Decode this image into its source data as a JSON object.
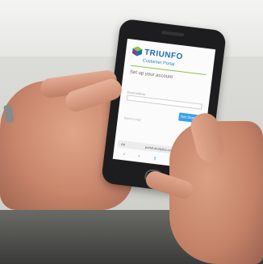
{
  "brand": {
    "name": "TRIUNFO",
    "colors": {
      "blue": "#1f6fa6",
      "green": "#8cc63f",
      "purple": "#7b3f9e"
    }
  },
  "portal": {
    "title": "Customer Portal",
    "setup_title": "Set up your account",
    "setup_text": "",
    "email_label": "Email Address",
    "email_placeholder": "",
    "button_label": "Get Started",
    "login_link": "Back to Login"
  },
  "browser": {
    "url": "portal.analytics.com",
    "text_size_label": "AA"
  },
  "icons": [
    "logo-icon",
    "refresh-icon",
    "share-icon",
    "bookmarks-icon",
    "tabs-icon",
    "back-icon",
    "forward-icon"
  ]
}
